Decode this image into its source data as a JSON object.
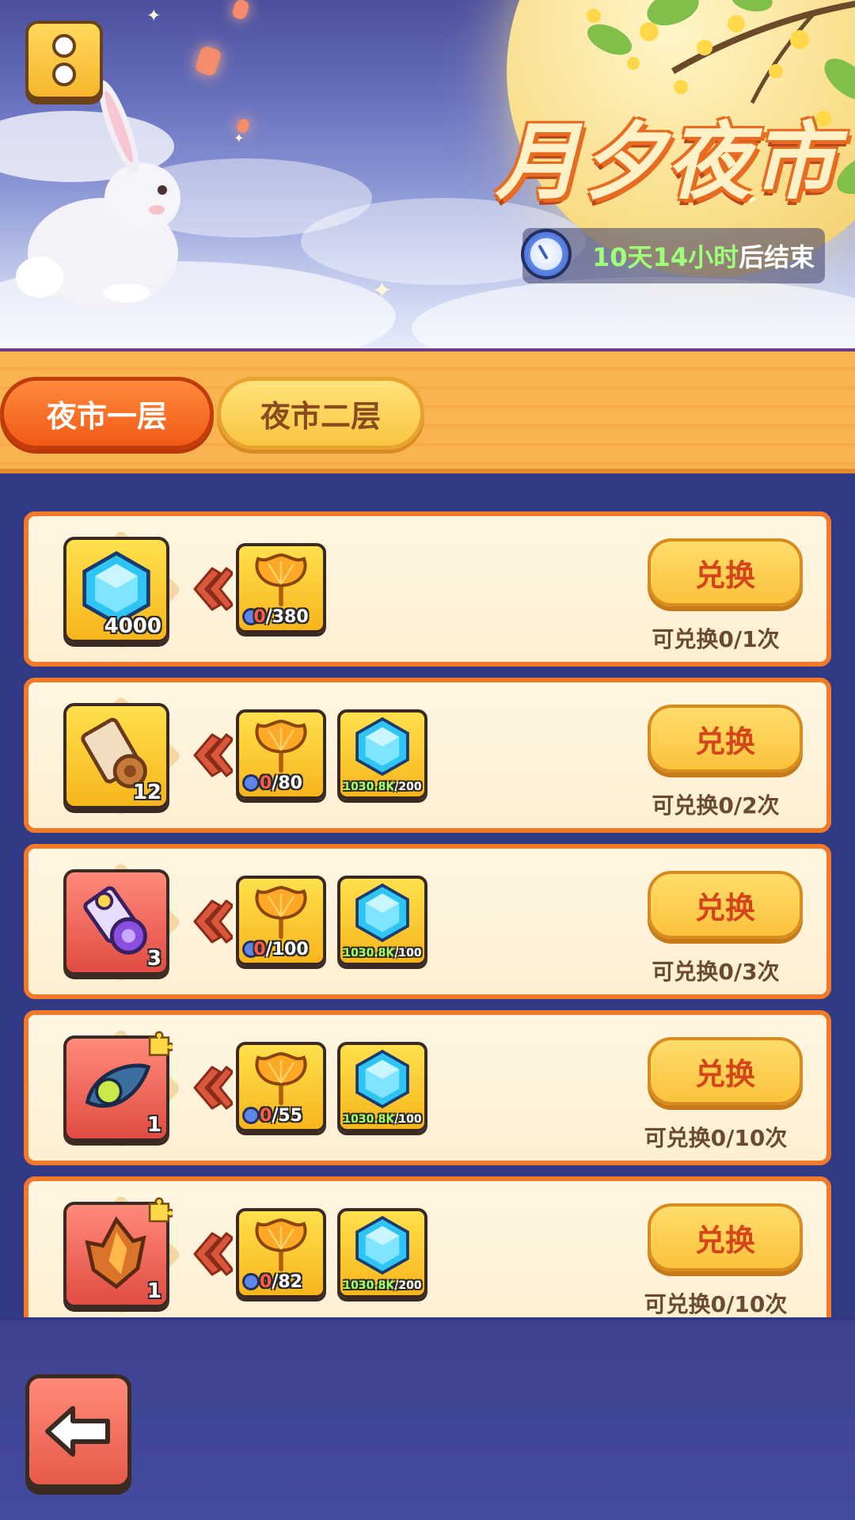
{
  "header": {
    "title": "月夕夜市",
    "timer": {
      "highlight": "10天14小时",
      "suffix": "后结束"
    }
  },
  "tabs": [
    {
      "label": "夜市一层",
      "active": true
    },
    {
      "label": "夜市二层",
      "active": false
    }
  ],
  "items": [
    {
      "reward": {
        "icon": "blue-gem-icon",
        "qty": "4000",
        "bg": "gold"
      },
      "costs": [
        {
          "icon": "ginkgo-leaf-icon",
          "have": "0",
          "need": "/380"
        }
      ],
      "button": "兑换",
      "limit": "可兑换0/1次"
    },
    {
      "reward": {
        "icon": "scroll-icon",
        "qty": "12",
        "bg": "gold"
      },
      "costs": [
        {
          "icon": "ginkgo-leaf-icon",
          "have": "0",
          "need": "/80"
        },
        {
          "icon": "blue-gem-icon",
          "have": "1030.8K",
          "need": "/200"
        }
      ],
      "button": "兑换",
      "limit": "可兑换0/2次"
    },
    {
      "reward": {
        "icon": "purple-scroll-icon",
        "qty": "3",
        "bg": "red"
      },
      "costs": [
        {
          "icon": "ginkgo-leaf-icon",
          "have": "0",
          "need": "/100"
        },
        {
          "icon": "blue-gem-icon",
          "have": "1030.8K",
          "need": "/100"
        }
      ],
      "button": "兑换",
      "limit": "可兑换0/3次"
    },
    {
      "reward": {
        "icon": "pea-pod-fragment-icon",
        "qty": "1",
        "bg": "red"
      },
      "costs": [
        {
          "icon": "ginkgo-leaf-icon",
          "have": "0",
          "need": "/55"
        },
        {
          "icon": "blue-gem-icon",
          "have": "1030.8K",
          "need": "/100"
        }
      ],
      "button": "兑换",
      "limit": "可兑换0/10次"
    },
    {
      "reward": {
        "icon": "flame-crystal-fragment-icon",
        "qty": "1",
        "bg": "red"
      },
      "costs": [
        {
          "icon": "ginkgo-leaf-icon",
          "have": "0",
          "need": "/82"
        },
        {
          "icon": "blue-gem-icon",
          "have": "1030.8K",
          "need": "/200"
        }
      ],
      "button": "兑换",
      "limit": "可兑换0/10次"
    }
  ],
  "colors": {
    "accent_orange": "#f07a2a",
    "button_yellow": "#fbc23c",
    "button_text": "#d4461a",
    "page_bg": "#333a85"
  }
}
